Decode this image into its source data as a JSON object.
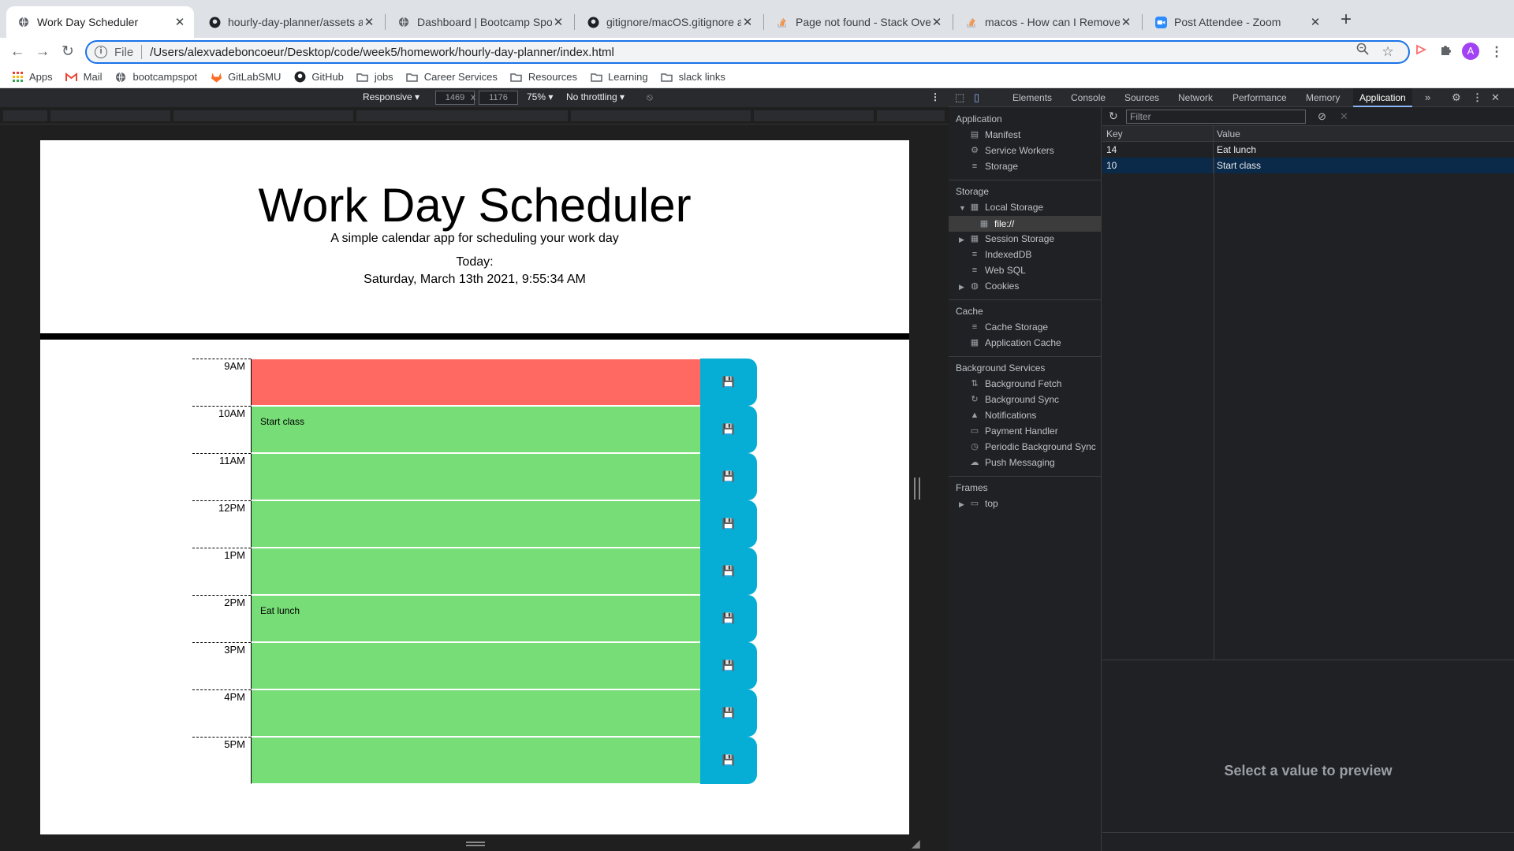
{
  "browser": {
    "tabs": [
      {
        "title": "Work Day Scheduler",
        "icon": "globe-icon",
        "active": true
      },
      {
        "title": "hourly-day-planner/assets at m",
        "icon": "github-icon",
        "active": false
      },
      {
        "title": "Dashboard | Bootcamp Spot",
        "icon": "globe-icon",
        "active": false
      },
      {
        "title": "gitignore/macOS.gitignore at m",
        "icon": "github-icon",
        "active": false
      },
      {
        "title": "Page not found - Stack Overflo",
        "icon": "stackoverflow-icon",
        "active": false
      },
      {
        "title": "macos - How can I Remove .DS",
        "icon": "stackoverflow-icon",
        "active": false
      },
      {
        "title": "Post Attendee - Zoom",
        "icon": "zoom-icon",
        "active": false
      }
    ],
    "new_tab": "+",
    "address": {
      "scheme": "File",
      "url": "/Users/alexvadeboncoeur/Desktop/code/week5/homework/hourly-day-planner/index.html"
    },
    "profile_initial": "A",
    "bookmarks": [
      {
        "label": "Apps",
        "icon": "apps-grid-icon"
      },
      {
        "label": "Mail",
        "icon": "gmail-icon"
      },
      {
        "label": "bootcampspot",
        "icon": "globe-icon"
      },
      {
        "label": "GitLabSMU",
        "icon": "gitlab-icon"
      },
      {
        "label": "GitHub",
        "icon": "github-icon"
      },
      {
        "label": "jobs",
        "icon": "folder-icon"
      },
      {
        "label": "Career Services",
        "icon": "folder-icon"
      },
      {
        "label": "Resources",
        "icon": "folder-icon"
      },
      {
        "label": "Learning",
        "icon": "folder-icon"
      },
      {
        "label": "slack links",
        "icon": "folder-icon"
      }
    ]
  },
  "device_toolbar": {
    "mode": "Responsive ▾",
    "width": "1469",
    "times": "x",
    "height": "1176",
    "zoom": "75% ▾",
    "throttling": "No throttling ▾"
  },
  "app": {
    "title": "Work Day Scheduler",
    "lead": "A simple calendar app for scheduling your work day",
    "today_label": "Today:",
    "current_day": "Saturday, March 13th 2021, 9:55:34 AM",
    "time_blocks": [
      {
        "hour": "9AM",
        "text": "",
        "state": "present"
      },
      {
        "hour": "10AM",
        "text": "Start class",
        "state": "future"
      },
      {
        "hour": "11AM",
        "text": "",
        "state": "future"
      },
      {
        "hour": "12PM",
        "text": "",
        "state": "future"
      },
      {
        "hour": "1PM",
        "text": "",
        "state": "future"
      },
      {
        "hour": "2PM",
        "text": "Eat lunch",
        "state": "future"
      },
      {
        "hour": "3PM",
        "text": "",
        "state": "future"
      },
      {
        "hour": "4PM",
        "text": "",
        "state": "future"
      },
      {
        "hour": "5PM",
        "text": "",
        "state": "future"
      }
    ],
    "colors": {
      "past": "#d3d3d3",
      "present": "#ff6961",
      "future": "#77dd77",
      "save": "#06aed5"
    }
  },
  "devtools": {
    "tabs": [
      "Elements",
      "Console",
      "Sources",
      "Network",
      "Performance",
      "Memory",
      "Application"
    ],
    "active_tab": "Application",
    "sidebar": {
      "application": {
        "heading": "Application",
        "items": [
          "Manifest",
          "Service Workers",
          "Storage"
        ]
      },
      "storage": {
        "heading": "Storage",
        "items": [
          "Local Storage",
          "file://",
          "Session Storage",
          "IndexedDB",
          "Web SQL",
          "Cookies"
        ]
      },
      "cache": {
        "heading": "Cache",
        "items": [
          "Cache Storage",
          "Application Cache"
        ]
      },
      "background": {
        "heading": "Background Services",
        "items": [
          "Background Fetch",
          "Background Sync",
          "Notifications",
          "Payment Handler",
          "Periodic Background Sync",
          "Push Messaging"
        ]
      },
      "frames": {
        "heading": "Frames",
        "items": [
          "top"
        ]
      }
    },
    "filter_placeholder": "Filter",
    "table": {
      "headers": {
        "key": "Key",
        "value": "Value"
      },
      "rows": [
        {
          "key": "14",
          "value": "Eat lunch"
        },
        {
          "key": "10",
          "value": "Start class"
        }
      ]
    },
    "preview": "Select a value to preview"
  }
}
